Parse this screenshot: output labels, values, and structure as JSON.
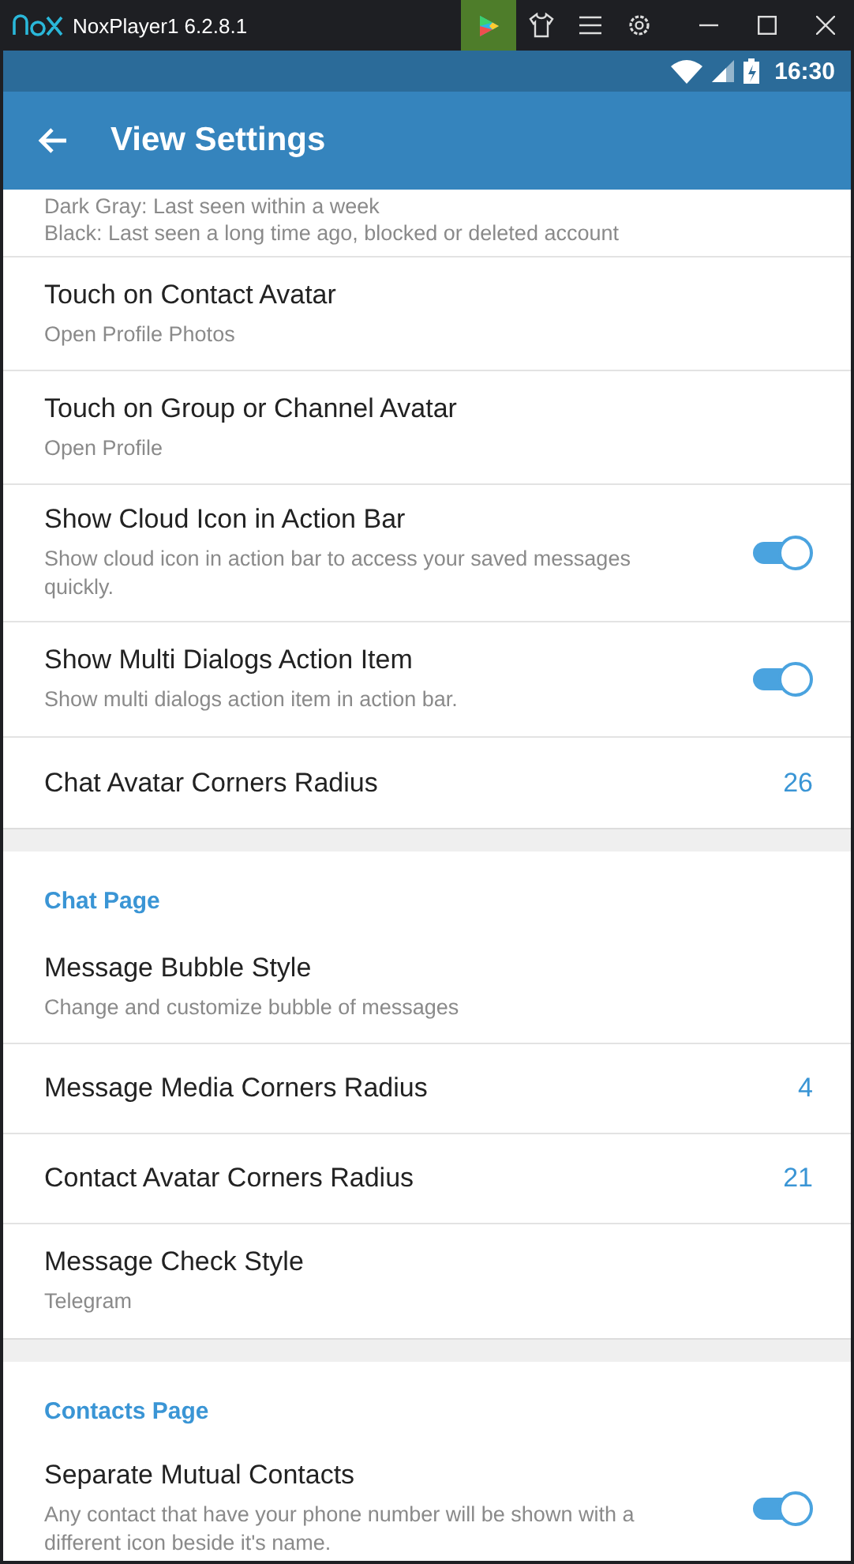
{
  "window": {
    "title": "NoxPlayer1 6.2.8.1",
    "tools": [
      {
        "kind": "play",
        "selected": true
      },
      {
        "kind": "shirt",
        "selected": false
      },
      {
        "kind": "menu",
        "selected": false
      },
      {
        "kind": "settings",
        "selected": false
      }
    ],
    "controls": [
      {
        "kind": "minimize"
      },
      {
        "kind": "maximize"
      },
      {
        "kind": "close"
      }
    ]
  },
  "status_bar": {
    "time": "16:30"
  },
  "app_bar": {
    "title": "View Settings"
  },
  "sections": [
    {
      "items": [
        {
          "kind": "note",
          "lines": [
            "Dark Gray: Last seen within a week",
            "Black: Last seen a long time ago, blocked or deleted account"
          ]
        },
        {
          "kind": "text",
          "title": "Touch on Contact Avatar",
          "subtitle": "Open Profile Photos"
        },
        {
          "kind": "text",
          "title": "Touch on Group or Channel Avatar",
          "subtitle": "Open Profile"
        },
        {
          "kind": "toggle",
          "title": "Show Cloud Icon in Action Bar",
          "subtitle": "Show cloud icon in action bar to access your saved messages quickly.",
          "on": true
        },
        {
          "kind": "toggle",
          "title": "Show Multi Dialogs Action Item",
          "subtitle": "Show multi dialogs action item in action bar.",
          "on": true
        },
        {
          "kind": "value",
          "title": "Chat Avatar Corners Radius",
          "value": "26"
        }
      ]
    },
    {
      "header": "Chat Page",
      "items": [
        {
          "kind": "text",
          "title": "Message Bubble Style",
          "subtitle": "Change and customize bubble of messages"
        },
        {
          "kind": "value",
          "title": "Message Media Corners Radius",
          "value": "4"
        },
        {
          "kind": "value",
          "title": "Contact Avatar Corners Radius",
          "value": "21"
        },
        {
          "kind": "text",
          "title": "Message Check Style",
          "subtitle": "Telegram"
        }
      ]
    },
    {
      "header": "Contacts Page",
      "items": [
        {
          "kind": "toggle",
          "title": "Separate Mutual Contacts",
          "subtitle": "Any contact that have your phone number will be shown with a different icon beside it's name.",
          "on": true
        }
      ]
    }
  ]
}
